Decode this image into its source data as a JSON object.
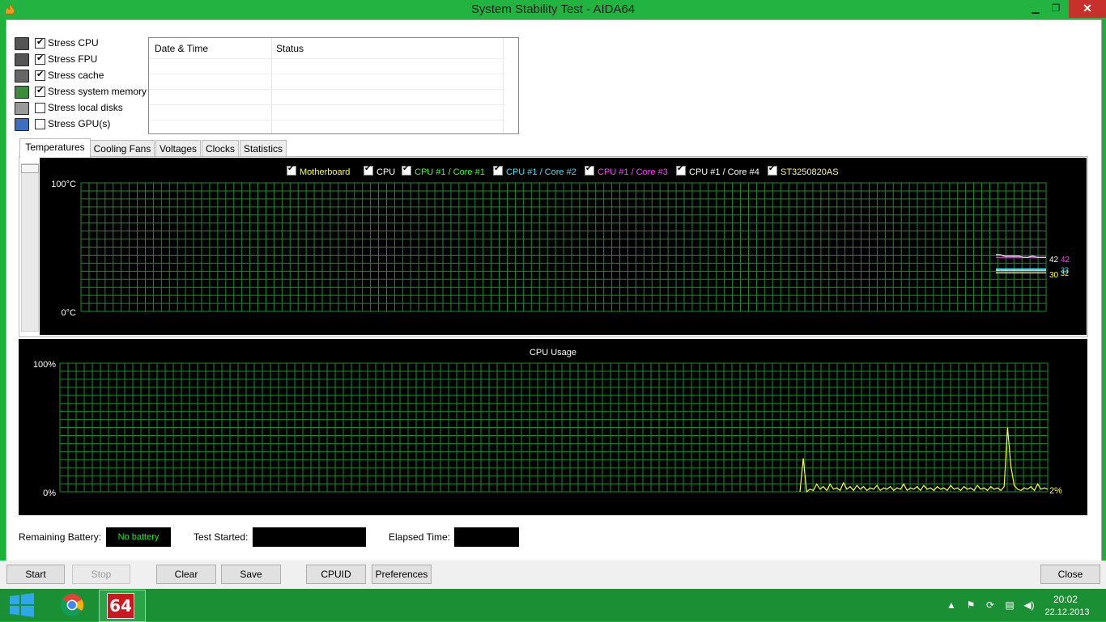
{
  "window": {
    "title": "System Stability Test - AIDA64",
    "minimize_icon": "minimize-icon",
    "restore_icon": "restore-icon",
    "close_icon": "close-icon"
  },
  "stress_options": [
    {
      "label": "Stress CPU",
      "checked": true,
      "icon": "cpu-icon"
    },
    {
      "label": "Stress FPU",
      "checked": true,
      "icon": "fpu-icon"
    },
    {
      "label": "Stress cache",
      "checked": true,
      "icon": "cache-icon"
    },
    {
      "label": "Stress system memory",
      "checked": true,
      "icon": "memory-icon"
    },
    {
      "label": "Stress local disks",
      "checked": false,
      "icon": "disk-icon"
    },
    {
      "label": "Stress GPU(s)",
      "checked": false,
      "icon": "gpu-icon"
    }
  ],
  "log": {
    "columns": [
      "Date & Time",
      "Status"
    ]
  },
  "tabs": [
    "Temperatures",
    "Cooling Fans",
    "Voltages",
    "Clocks",
    "Statistics"
  ],
  "temp_chart_text": {
    "y_max": "100°C",
    "y_min": "0°C",
    "readout_1": "42",
    "readout_2": "42",
    "readout_3": "30",
    "readout_4": "33",
    "readout_5": "32"
  },
  "cpu_chart_text": {
    "title": "CPU Usage",
    "y_max": "100%",
    "y_min": "0%",
    "current": "2%"
  },
  "chart_data": [
    {
      "type": "line",
      "ylim": [
        0,
        100
      ],
      "unit": "°C",
      "grid": true,
      "legend": "top-center",
      "series": [
        {
          "name": "Motherboard",
          "color": "#ffff40",
          "values": [
            30,
            30,
            30,
            30,
            30,
            30,
            30,
            30,
            30,
            30,
            30,
            30
          ]
        },
        {
          "name": "CPU",
          "color": "#ffffff",
          "values": [
            32,
            32,
            32,
            32,
            32,
            32,
            32,
            32,
            32,
            32,
            32,
            32
          ]
        },
        {
          "name": "CPU #1 / Core #1",
          "color": "#40ff40",
          "values": [
            33,
            33,
            33,
            33,
            33,
            33,
            33,
            33,
            33,
            33,
            33,
            33
          ]
        },
        {
          "name": "CPU #1 / Core #2",
          "color": "#40e0ff",
          "values": [
            33,
            33,
            33,
            33,
            33,
            33,
            33,
            33,
            33,
            33,
            33,
            33
          ]
        },
        {
          "name": "CPU #1 / Core #3",
          "color": "#ff40ff",
          "values": [
            42,
            42,
            42,
            42,
            42,
            42,
            42,
            42,
            42,
            42,
            42,
            42
          ]
        },
        {
          "name": "CPU #1 / Core #4",
          "color": "#ffffff",
          "values": [
            44,
            44,
            43,
            43,
            43,
            43,
            42,
            42,
            43,
            42,
            42,
            42
          ]
        },
        {
          "name": "ST3250820AS",
          "color": "#ffff80",
          "values": [
            30,
            30,
            30,
            30,
            30,
            30,
            30,
            30,
            30,
            30,
            30,
            30
          ]
        }
      ]
    },
    {
      "type": "line",
      "title": "CPU Usage",
      "ylim": [
        0,
        100
      ],
      "unit": "%",
      "grid": true,
      "series": [
        {
          "color": "#ffff40",
          "values": [
            0,
            26,
            0,
            2,
            1,
            6,
            2,
            4,
            1,
            6,
            2,
            3,
            1,
            7,
            2,
            4,
            1,
            5,
            2,
            4,
            1,
            3,
            2,
            5,
            1,
            3,
            2,
            4,
            1,
            3,
            2,
            6,
            1,
            3,
            2,
            4,
            1,
            5,
            2,
            3,
            1,
            4,
            2,
            3,
            1,
            5,
            2,
            3,
            1,
            4,
            2,
            3,
            1,
            5,
            2,
            3,
            1,
            4,
            2,
            3,
            1,
            4,
            50,
            20,
            5,
            2,
            1,
            3,
            2,
            4,
            1,
            6,
            2,
            3,
            2
          ]
        }
      ]
    }
  ],
  "status": {
    "battery_label": "Remaining Battery:",
    "battery_value": "No battery",
    "test_started_label": "Test Started:",
    "test_started_value": "",
    "elapsed_label": "Elapsed Time:",
    "elapsed_value": ""
  },
  "buttons": {
    "start": "Start",
    "stop": "Stop",
    "clear": "Clear",
    "save": "Save",
    "cpuid": "CPUID",
    "preferences": "Preferences",
    "close": "Close"
  },
  "taskbar": {
    "start_icon": "windows-logo-icon",
    "pinned": [
      "chrome-icon",
      "aida64-icon"
    ],
    "aida_label": "64",
    "tray_icons": [
      "show-hidden-icons-icon",
      "action-center-flag-icon",
      "sync-icon",
      "network-icon",
      "volume-icon"
    ],
    "time": "20:02",
    "date": "22.12.2013"
  }
}
